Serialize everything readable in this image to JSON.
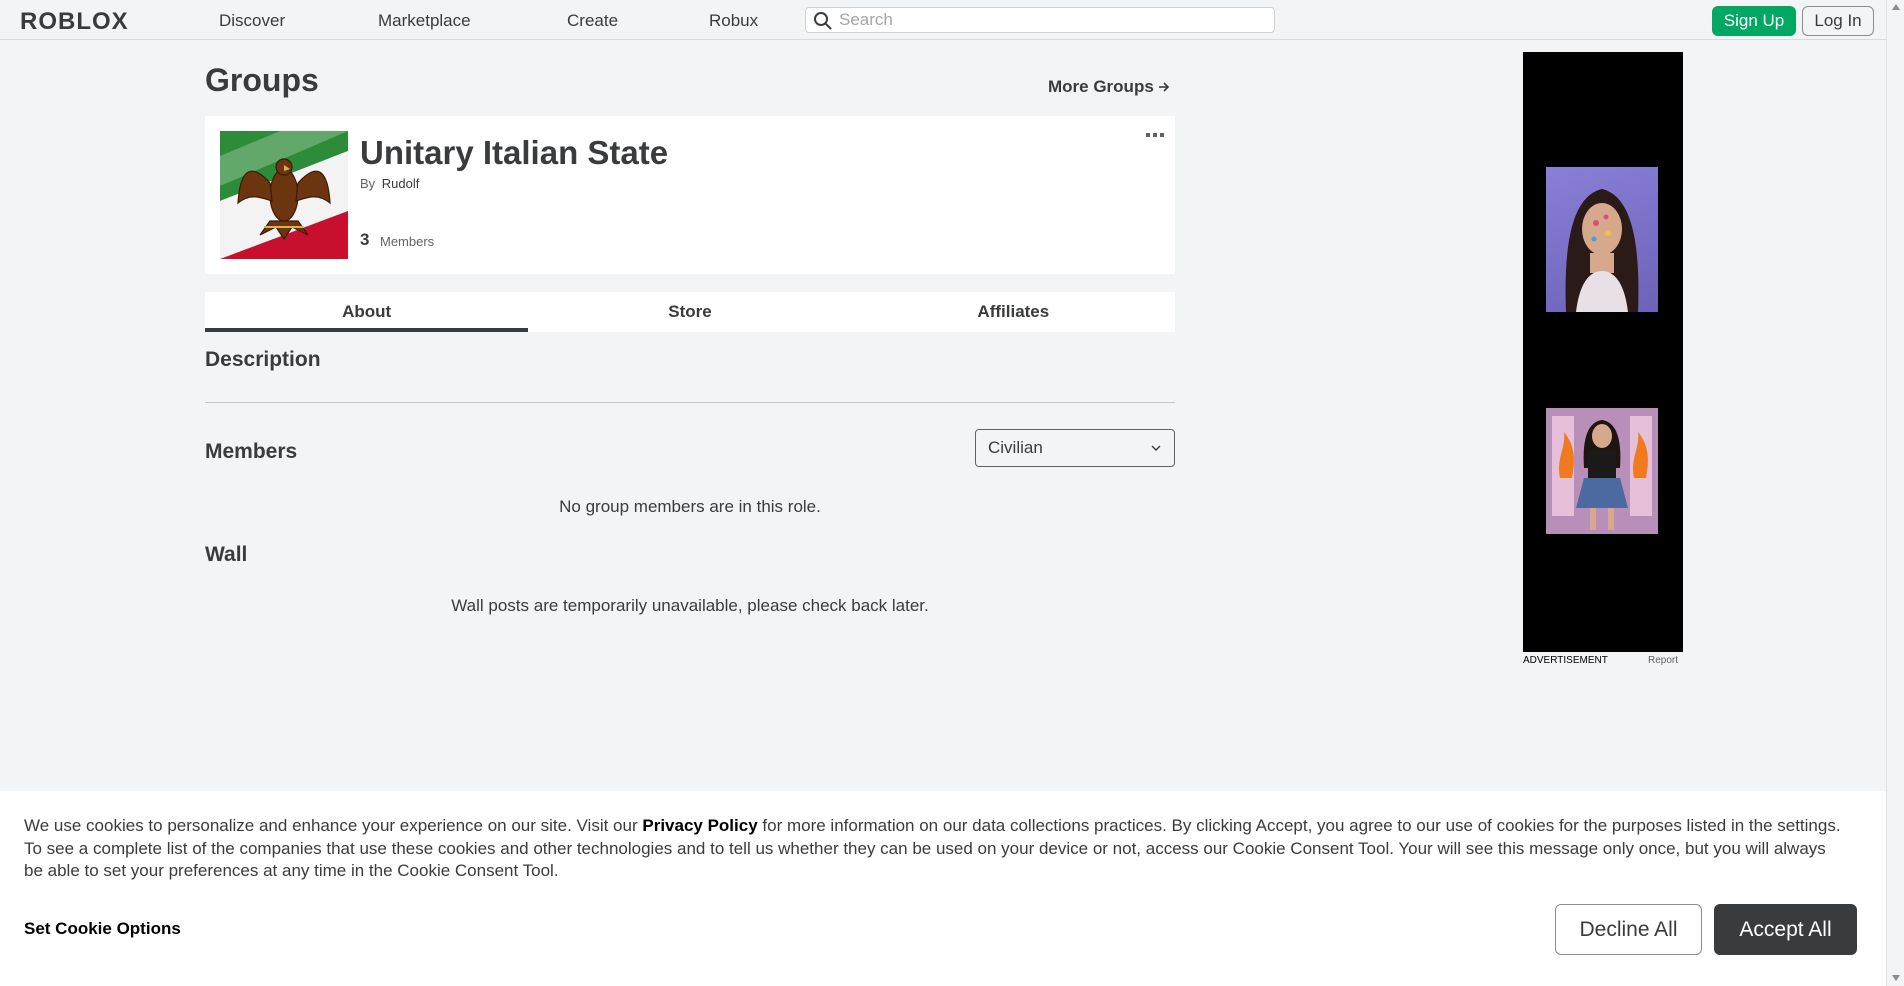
{
  "nav": {
    "logo": "ROBLOX",
    "links": [
      "Discover",
      "Marketplace",
      "Create",
      "Robux"
    ],
    "search_placeholder": "Search",
    "signup": "Sign Up",
    "login": "Log In"
  },
  "page": {
    "title": "Groups",
    "more_groups": "More Groups",
    "more_groups_icon": "arrow-right-icon"
  },
  "group": {
    "name": "Unitary Italian State",
    "by_label": "By",
    "owner": "Rudolf",
    "member_count": "3",
    "member_label": "Members",
    "emblem_colors": [
      "#2e8b3a",
      "#ffffff",
      "#c8102e"
    ],
    "emblem_icon": "eagle-emblem-icon"
  },
  "tabs": [
    "About",
    "Store",
    "Affiliates"
  ],
  "active_tab": "About",
  "about": {
    "description_title": "Description",
    "members_title": "Members",
    "role_selected": "Civilian",
    "no_members_msg": "No group members are in this role.",
    "wall_title": "Wall",
    "wall_msg": "Wall posts are temporarily unavailable, please check back later."
  },
  "ad": {
    "label": "ADVERTISEMENT",
    "report": "Report"
  },
  "cookie": {
    "text_before": "We use cookies to personalize and enhance your experience on our site. Visit our ",
    "privacy_link": "Privacy Policy",
    "text_after": " for more information on our data collections practices. By clicking Accept, you agree to our use of cookies for the purposes listed in the settings. To see a complete list of the companies that use these cookies and other technologies and to tell us whether they can be used on your device or not, access our Cookie Consent Tool. Your will see this message only once, but you will always be able to set your preferences at any time in the Cookie Consent Tool.",
    "set_options": "Set Cookie Options",
    "decline": "Decline All",
    "accept": "Accept All"
  },
  "colors": {
    "brand_green": "#00a863",
    "text_dark": "#393b3d",
    "background": "#f2f4f5"
  }
}
